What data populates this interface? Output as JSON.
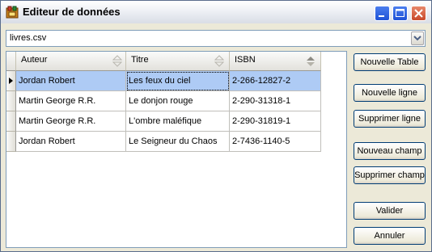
{
  "window": {
    "title": "Editeur de données"
  },
  "file_selector": {
    "value": "livres.csv"
  },
  "grid": {
    "columns": [
      "Auteur",
      "Titre",
      "ISBN"
    ],
    "rows": [
      [
        "Jordan Robert",
        "Les feux du ciel",
        "2-266-12827-2"
      ],
      [
        "Martin George R.R.",
        "Le donjon rouge",
        "2-290-31318-1"
      ],
      [
        "Martin George R.R.",
        "L'ombre maléfique",
        "2-290-31819-1"
      ],
      [
        "Jordan Robert",
        "Le Seigneur du Chaos",
        "2-7436-1140-5"
      ]
    ],
    "selected_row": 0
  },
  "buttons": {
    "new_table": "Nouvelle Table",
    "new_row": "Nouvelle ligne",
    "delete_row": "Supprimer ligne",
    "new_field": "Nouveau champ",
    "delete_field": "Supprimer champ",
    "validate": "Valider",
    "cancel": "Annuler"
  },
  "colors": {
    "selection": "#aecbf5",
    "title_bar": "#e6e9f0",
    "window_bg": "#ece9d8"
  }
}
